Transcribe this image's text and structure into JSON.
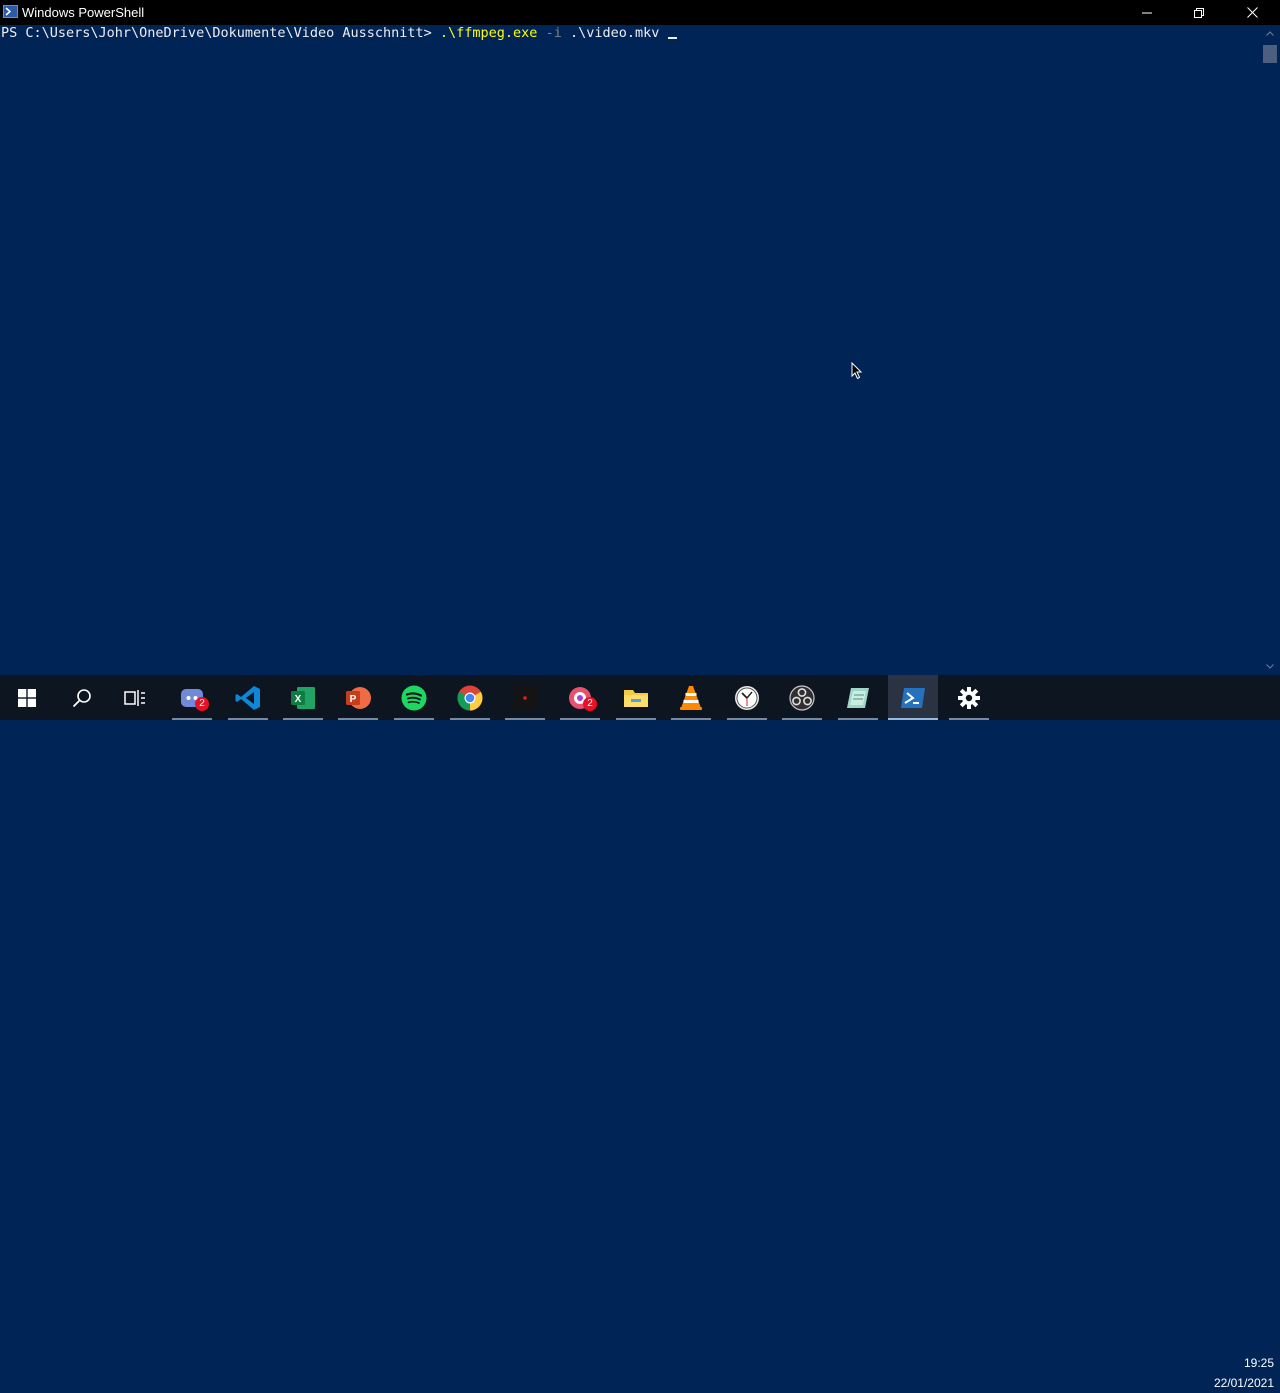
{
  "window": {
    "title": "Windows PowerShell",
    "controls": {
      "minimize": "minimize-icon",
      "restore": "restore-icon",
      "close": "close-icon"
    }
  },
  "console": {
    "prompt": "PS C:\\Users\\Johr\\OneDrive\\Dokumente\\Video Ausschnitt> ",
    "command": ".\\ffmpeg.exe",
    "flag": "-i",
    "argument": ".\\video.mkv",
    "colors": {
      "background": "#012456",
      "text": "#eeedf0",
      "command": "#ffff00",
      "parameter": "#808080"
    }
  },
  "taskbar": {
    "apps": [
      {
        "name": "start",
        "icon": "windows-logo-icon"
      },
      {
        "name": "search",
        "icon": "search-icon"
      },
      {
        "name": "task-view",
        "icon": "task-view-icon"
      },
      {
        "name": "discord",
        "icon": "discord-icon",
        "badge": "2"
      },
      {
        "name": "vscode",
        "icon": "vscode-icon"
      },
      {
        "name": "excel",
        "icon": "excel-icon"
      },
      {
        "name": "powerpoint",
        "icon": "powerpoint-icon"
      },
      {
        "name": "spotify",
        "icon": "spotify-icon"
      },
      {
        "name": "chrome",
        "icon": "chrome-icon"
      },
      {
        "name": "recorder",
        "icon": "record-icon"
      },
      {
        "name": "messenger",
        "icon": "messenger-icon",
        "badge": "2"
      },
      {
        "name": "file-explorer",
        "icon": "folder-icon"
      },
      {
        "name": "vlc",
        "icon": "vlc-icon"
      },
      {
        "name": "clock-app",
        "icon": "clock-icon"
      },
      {
        "name": "obs",
        "icon": "obs-icon"
      },
      {
        "name": "notes",
        "icon": "notes-icon"
      },
      {
        "name": "powershell",
        "icon": "powershell-icon"
      },
      {
        "name": "settings",
        "icon": "gear-icon"
      }
    ],
    "time": "19:25",
    "date": "22/01/2021"
  }
}
